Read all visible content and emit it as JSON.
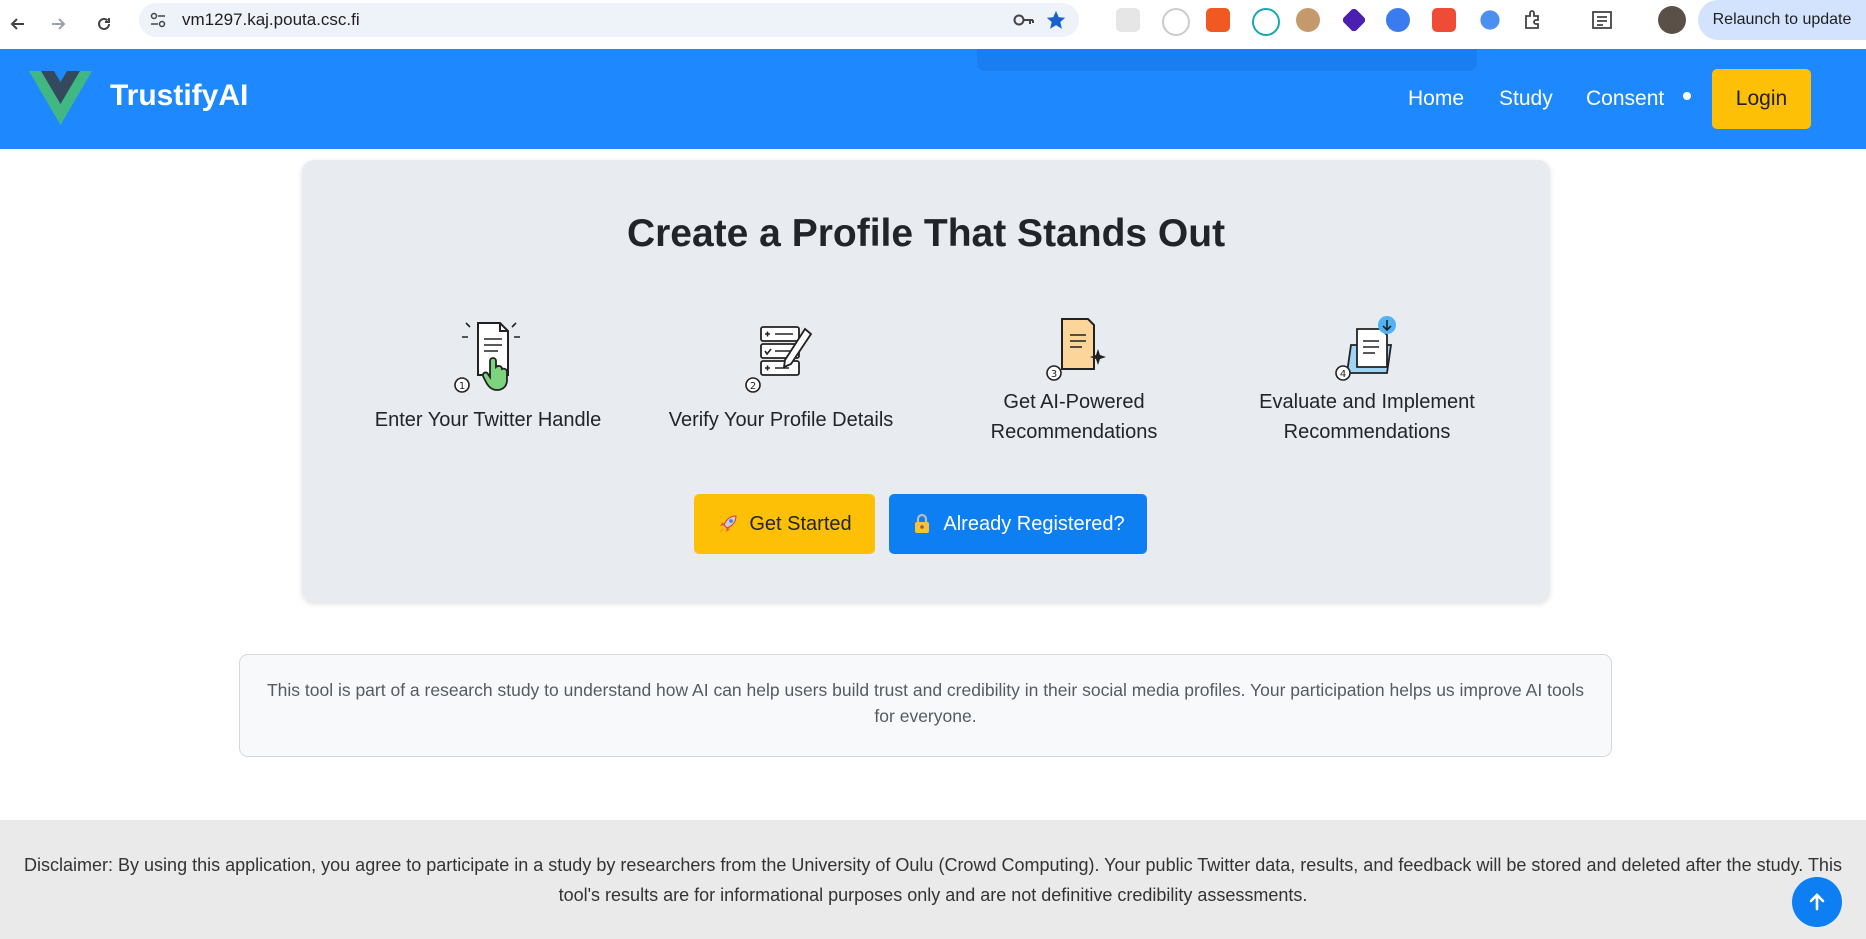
{
  "browser": {
    "url": "vm1297.kaj.pouta.csc.fi",
    "relaunch_label": "Relaunch to update",
    "icons": [
      "back-icon",
      "forward-icon",
      "reload-icon",
      "site-settings-icon",
      "key-icon",
      "star-icon",
      "extension-icon",
      "profile-avatar"
    ]
  },
  "navbar": {
    "brand": "TrustifyAI",
    "links": [
      "Home",
      "Study",
      "Consent"
    ],
    "login": "Login",
    "colors": {
      "background": "#1e88fe",
      "login": "#fec007"
    }
  },
  "hero": {
    "title": "Create a Profile That Stands Out",
    "steps": [
      {
        "number": "1",
        "label": "Enter Your Twitter Handle",
        "icon": "document-tap-icon"
      },
      {
        "number": "2",
        "label": "Verify Your Profile Details",
        "icon": "checklist-pencil-icon"
      },
      {
        "number": "3",
        "label": "Get AI-Powered Recommendations",
        "icon": "document-sparkle-icon"
      },
      {
        "number": "4",
        "label": "Evaluate and Implement Recommendations",
        "icon": "folder-download-icon"
      }
    ],
    "get_started": "Get Started",
    "already_registered": "Already Registered?"
  },
  "info_note": "This tool is part of a research study to understand how AI can help users build trust and credibility in their social media profiles. Your participation helps us improve AI tools for everyone.",
  "footer": {
    "disclaimer": "Disclaimer: By using this application, you agree to participate in a study by researchers from the University of Oulu (Crowd Computing). Your public Twitter data, results, and feedback will be stored and deleted after the study. This tool's results are for informational purposes only and are not definitive credibility assessments."
  }
}
